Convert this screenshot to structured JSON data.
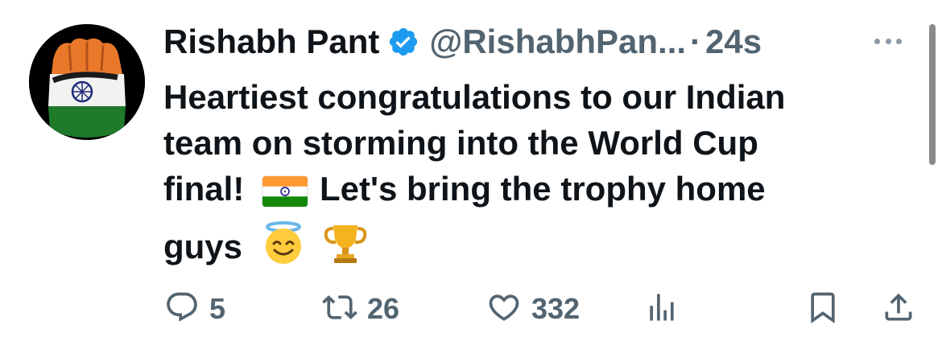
{
  "author": {
    "name": "Rishabh Pant",
    "handle": "@RishabhPan...",
    "separator": "·",
    "time": "24s"
  },
  "tweet": {
    "lines": [
      "Heartiest congratulations to our  Indian",
      "team on storming into the World Cup",
      "final!",
      "Let's bring the trophy home",
      "guys"
    ],
    "emojis": [
      "india-flag",
      "smiling-face-with-halo",
      "trophy"
    ]
  },
  "actions": {
    "replies": "5",
    "retweets": "26",
    "likes": "332"
  },
  "colors": {
    "verified": "#1d9bf0",
    "muted": "#536471",
    "text": "#0f1419",
    "saffron": "#ff9933",
    "green": "#138808",
    "navy": "#000080"
  }
}
